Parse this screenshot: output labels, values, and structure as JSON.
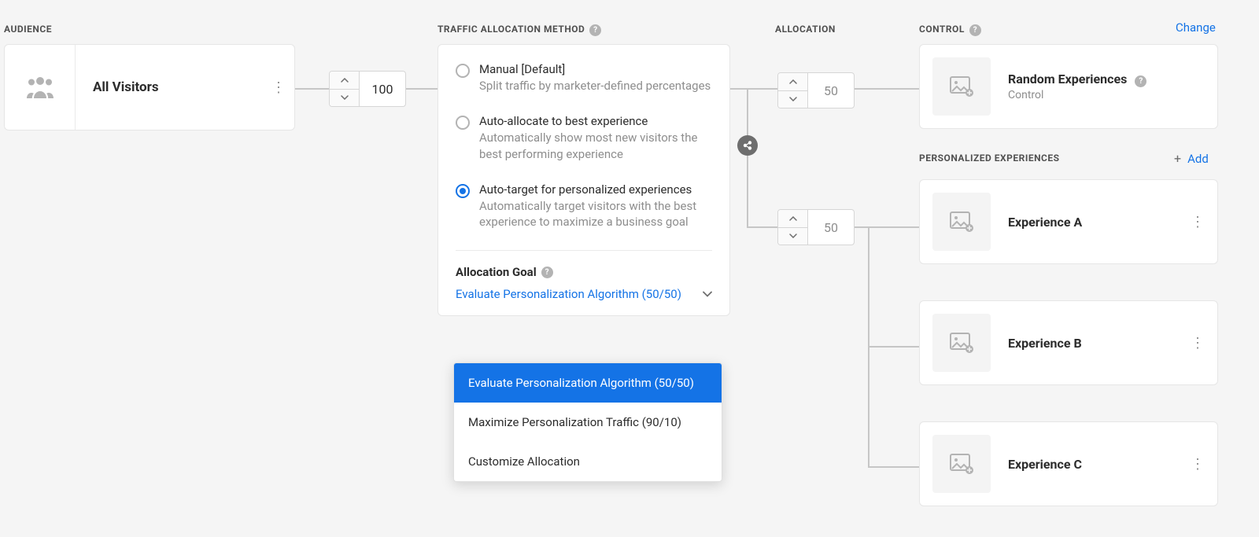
{
  "sections": {
    "audience": "AUDIENCE",
    "traffic": "TRAFFIC ALLOCATION METHOD",
    "allocation": "ALLOCATION",
    "control": "CONTROL",
    "personalized": "PERSONALIZED EXPERIENCES"
  },
  "audience": {
    "name": "All Visitors"
  },
  "steppers": {
    "total": "100",
    "control": "50",
    "personalized": "50"
  },
  "traffic_methods": [
    {
      "title": "Manual [Default]",
      "desc": "Split traffic by marketer-defined percentages",
      "selected": false
    },
    {
      "title": "Auto-allocate to best experience",
      "desc": "Automatically show most new visitors the best performing experience",
      "selected": false
    },
    {
      "title": "Auto-target for personalized experiences",
      "desc": "Automatically target visitors with the best experience to maximize a business goal",
      "selected": true
    }
  ],
  "allocation_goal": {
    "label": "Allocation Goal",
    "selected": "Evaluate Personalization Algorithm (50/50)",
    "options": [
      "Evaluate Personalization Algorithm (50/50)",
      "Maximize Personalization Traffic (90/10)",
      "Customize Allocation"
    ]
  },
  "control_card": {
    "title": "Random Experiences",
    "sub": "Control",
    "change": "Change"
  },
  "personalized_header": {
    "add": "Add"
  },
  "experiences": [
    {
      "title": "Experience A"
    },
    {
      "title": "Experience B"
    },
    {
      "title": "Experience C"
    }
  ]
}
